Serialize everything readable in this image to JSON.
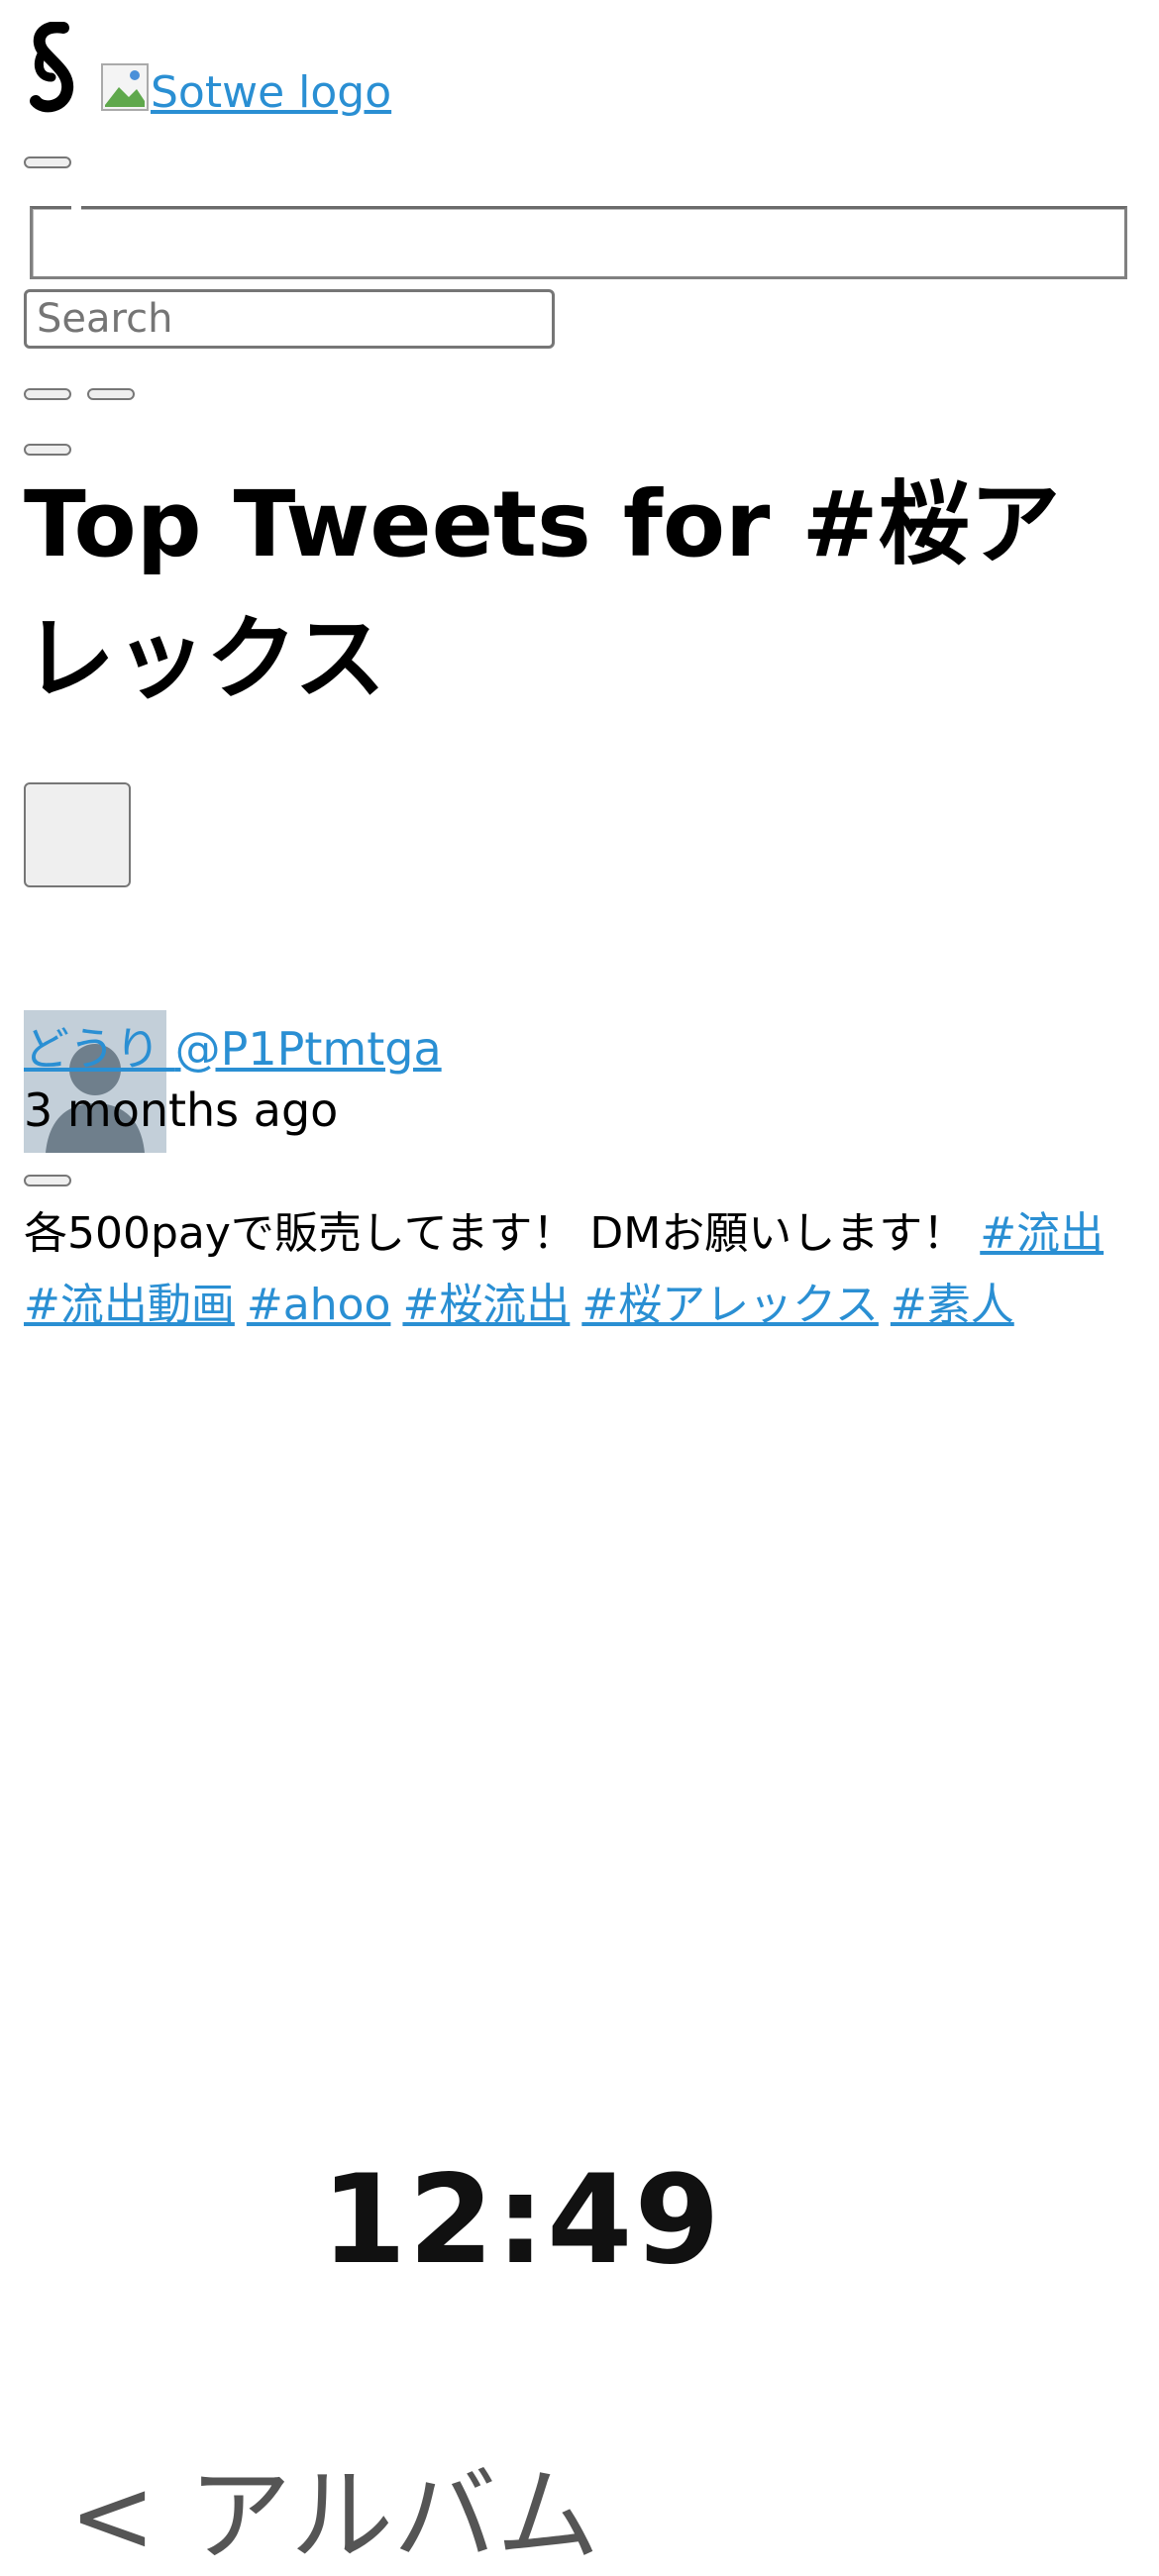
{
  "header": {
    "logo_alt": "Sotwe logo"
  },
  "search": {
    "placeholder": "Search"
  },
  "page": {
    "title": "Top Tweets for #桜アレックス"
  },
  "tweet": {
    "author_name": "どうり",
    "author_handle": "@P1Ptmtga",
    "time": "3 months ago",
    "text": "各500payで販売してます！ DMお願いします！",
    "hashtags": [
      "#流出",
      "#流出動画",
      "#ahoo",
      "#桜流出",
      "#桜アレックス",
      "#素人"
    ]
  },
  "media_preview": {
    "clock": "12:49",
    "album_label": "< アルバム"
  },
  "colors": {
    "link": "#2a8fd3",
    "avatar_bg": "#c3cfd9",
    "avatar_fg": "#6f7f8c"
  }
}
